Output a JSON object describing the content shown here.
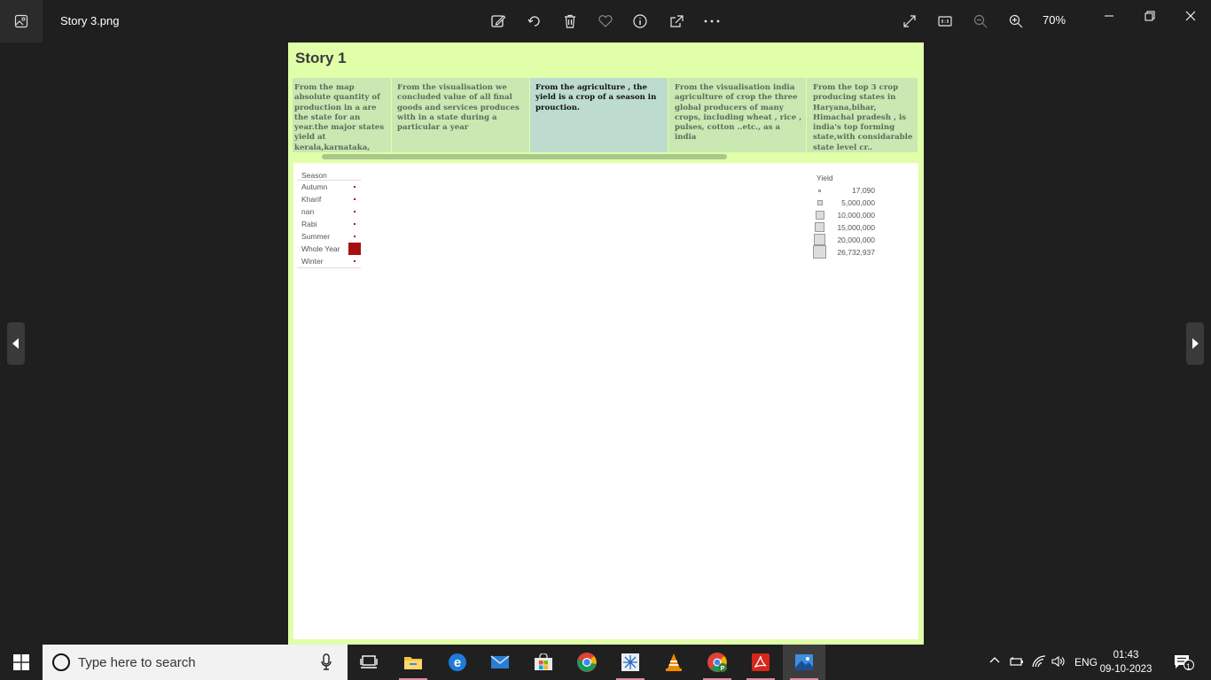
{
  "window": {
    "title": "Story 3.png",
    "zoom": "70%"
  },
  "story": {
    "title": "Story 1",
    "captions": [
      " From the map absolute quantity of production in a are the state for an year.the major states yield at kerala,karnataka, tamilnadu andra prades..",
      " From the visualisation we concluded value of all final goods and services produces with in a state during a particular a year",
      "From  the  agriculture , the yield is a crop of a season in prouction.",
      "From the visualisation india agriculture of crop the three global producers of many crops, including wheat , rice , pulses, cotton ..etc., as a india",
      "From  the top  3 crop producing states in Haryana,bihar, Himachal pradesh ,  is india's top forming state,with considarable state level cr.."
    ],
    "legend_season": {
      "title": "Season",
      "items": [
        "Autumn",
        "Kharif",
        "nan",
        "Rabi",
        "Summer",
        "Whole Year",
        "Winter"
      ],
      "highlight_color": "#a61010"
    },
    "legend_yield": {
      "title": "Yield",
      "items": [
        "17,090",
        "5,000,000",
        "10,000,000",
        "15,000,000",
        "20,000,000",
        "26,732,937"
      ]
    }
  },
  "taskbar": {
    "search_placeholder": "Type here to search",
    "language": "ENG",
    "time": "01:43",
    "date": "09-10-2023",
    "notification_count": "1"
  }
}
